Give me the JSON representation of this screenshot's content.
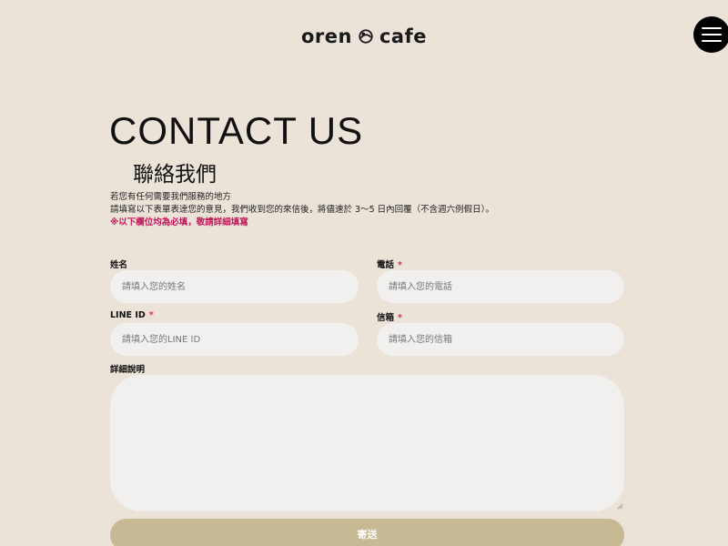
{
  "header": {
    "logo_left": "oren",
    "logo_right": "cafe",
    "menu_icon": "hamburger-menu-icon"
  },
  "heading": {
    "title_en": "CONTACT US",
    "title_zh": "聯絡我們"
  },
  "intro": {
    "line1": "若您有任何需要我們服務的地方",
    "line2": "請填寫以下表單表達您的意見，我們收到您的來信後，將儘速於 3〜5 日內回覆（不含週六例假日）。",
    "required_note": "※以下欄位均為必填，敬請詳細填寫"
  },
  "form": {
    "name": {
      "label": "姓名",
      "placeholder": "請填入您的姓名"
    },
    "phone": {
      "label": "電話",
      "placeholder": "請填入您的電話",
      "required_mark": "*"
    },
    "line_id": {
      "label": "LINE ID",
      "placeholder": "請填入您的LINE ID",
      "required_mark": "*"
    },
    "email": {
      "label": "信箱",
      "placeholder": "請填入您的信箱",
      "required_mark": "*"
    },
    "details": {
      "label": "詳細說明",
      "value": ""
    },
    "submit_label": "寄送"
  },
  "colors": {
    "background": "#ebe2d8",
    "input_bg": "#f1f0ef",
    "submit_bg": "#c8b995",
    "required_accent": "#c2185b",
    "menu_bg": "#000000"
  }
}
